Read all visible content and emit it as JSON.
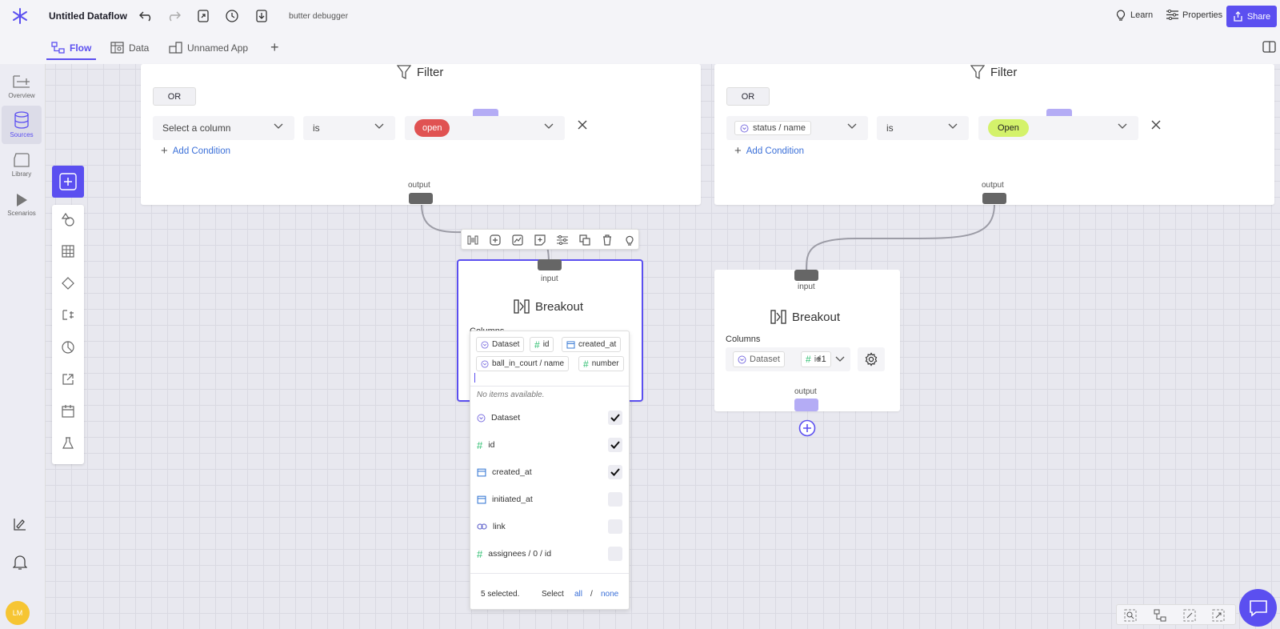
{
  "header": {
    "title": "Untitled Dataflow",
    "debug_label": "butter debugger",
    "learn": "Learn",
    "properties": "Properties",
    "share": "Share"
  },
  "tabs": [
    {
      "label": "Flow"
    },
    {
      "label": "Data"
    },
    {
      "label": "Unnamed App"
    }
  ],
  "sidebar": {
    "items": [
      {
        "label": "Overview"
      },
      {
        "label": "Sources"
      },
      {
        "label": "Library"
      },
      {
        "label": "Scenarios"
      }
    ],
    "avatar": "LM"
  },
  "filter_left": {
    "title": "Filter",
    "logic": "OR",
    "column_placeholder": "Select a column",
    "operator": "is",
    "value": "open",
    "value_color": "#e05252",
    "add_condition": "Add Condition",
    "output_label": "output"
  },
  "filter_right": {
    "title": "Filter",
    "logic": "OR",
    "column": "status / name",
    "operator": "is",
    "value": "Open",
    "value_color": "#d4f26b",
    "add_condition": "Add Condition",
    "output_label": "output"
  },
  "breakout_left": {
    "input_label": "input",
    "title": "Breakout",
    "columns_label": "Columns",
    "chips": [
      "Dataset",
      "id",
      "created_at",
      "ball_in_court / name",
      "number"
    ]
  },
  "dropdown": {
    "empty_text": "No items available.",
    "items": [
      {
        "label": "Dataset",
        "checked": true
      },
      {
        "label": "id",
        "checked": true
      },
      {
        "label": "created_at",
        "checked": true
      },
      {
        "label": "initiated_at",
        "checked": false
      },
      {
        "label": "link",
        "checked": false
      },
      {
        "label": "assignees / 0 / id",
        "checked": false
      }
    ],
    "selected_count": "5 selected.",
    "select_label": "Select",
    "all": "all",
    "sep": "/",
    "none": "none"
  },
  "breakout_right": {
    "input_label": "input",
    "title": "Breakout",
    "columns_label": "Columns",
    "chip_dataset": "Dataset",
    "chip_id": "id",
    "chip_count": "+1",
    "output_label": "output"
  },
  "colors": {
    "accent": "#5b4ff0",
    "link": "#3a6fd8",
    "number_icon": "#2fbf71",
    "date_icon": "#3a7bd5"
  }
}
